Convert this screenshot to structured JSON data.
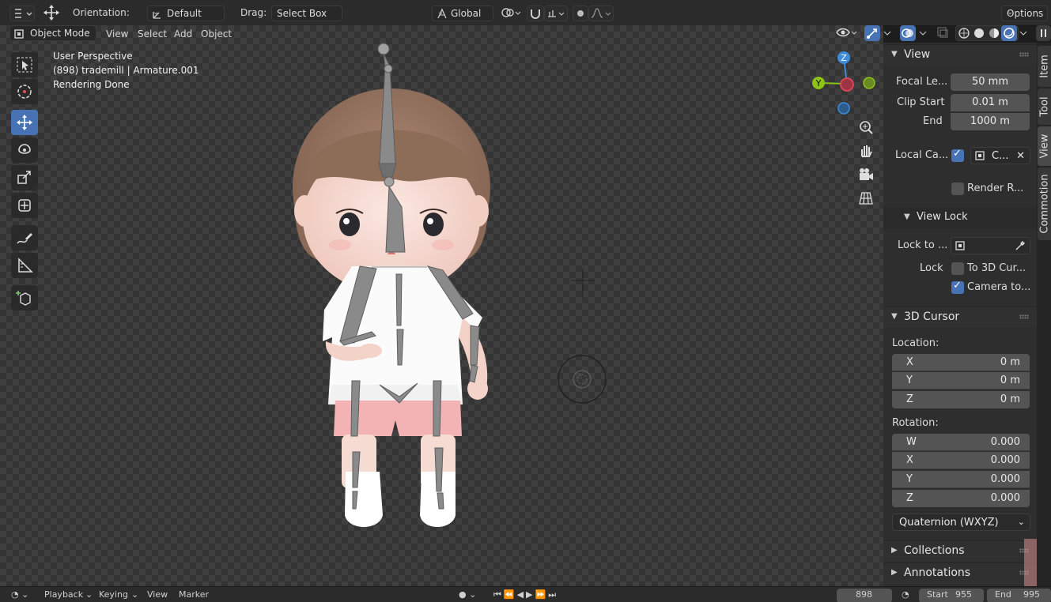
{
  "header": {
    "orientation_label": "Orientation:",
    "orientation_value": "Default",
    "drag_label": "Drag:",
    "drag_value": "Select Box",
    "transform_space": "Global",
    "options_label": "Options"
  },
  "viewport_header": {
    "mode": "Object Mode",
    "menus": [
      "View",
      "Select",
      "Add",
      "Object"
    ]
  },
  "overlay": {
    "line1": "User Perspective",
    "line2": "(898) trademill | Armature.001",
    "line3": "Rendering Done"
  },
  "gizmo": {
    "z": "Z",
    "y": "Y"
  },
  "toolbar": {
    "tools": [
      "select-box",
      "cursor",
      "move",
      "rotate",
      "scale",
      "transform",
      "annotate",
      "measure",
      "add-cube"
    ],
    "active": "move"
  },
  "sidebar": {
    "view_panel": {
      "title": "View",
      "focal_label": "Focal Le...",
      "focal_value": "50 mm",
      "clip_start_label": "Clip Start",
      "clip_start_value": "0.01 m",
      "end_label": "End",
      "end_value": "1000 m",
      "local_camera_label": "Local Ca...",
      "local_camera_value": "C...",
      "render_region_label": "Render R...",
      "view_lock_title": "View Lock",
      "lock_to_label": "Lock to ...",
      "lock_label": "Lock",
      "to_3d_cursor": "To 3D Cur...",
      "camera_to": "Camera to..."
    },
    "cursor_panel": {
      "title": "3D Cursor",
      "location_label": "Location:",
      "location": [
        {
          "axis": "X",
          "value": "0 m"
        },
        {
          "axis": "Y",
          "value": "0 m"
        },
        {
          "axis": "Z",
          "value": "0 m"
        }
      ],
      "rotation_label": "Rotation:",
      "rotation": [
        {
          "axis": "W",
          "value": "0.000"
        },
        {
          "axis": "X",
          "value": "0.000"
        },
        {
          "axis": "Y",
          "value": "0.000"
        },
        {
          "axis": "Z",
          "value": "0.000"
        }
      ],
      "rotation_mode": "Quaternion (WXYZ)"
    },
    "collections_title": "Collections",
    "annotations_title": "Annotations"
  },
  "tabs": [
    "Item",
    "Tool",
    "View",
    "Commotion"
  ],
  "active_tab": "View",
  "timeline": {
    "playback": "Playback",
    "keying": "Keying",
    "view": "View",
    "marker": "Marker",
    "current_frame": "898",
    "start_label": "Start",
    "start_value": "955",
    "end_label": "End",
    "end_value": "995"
  },
  "colors": {
    "accent": "#4772b3",
    "axis_x": "#e0485a",
    "axis_y": "#8cc21a",
    "axis_z": "#3d8ddc"
  }
}
